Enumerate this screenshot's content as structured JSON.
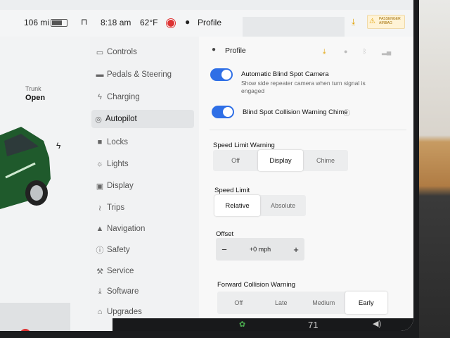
{
  "status": {
    "range": "106 mi",
    "time": "8:18 am",
    "temp": "62°F",
    "profile": "Profile",
    "airbag": "PASSENGER AIRBAG"
  },
  "car": {
    "trunk_label": "Trunk",
    "trunk_value": "Open"
  },
  "menu": [
    {
      "label": "Controls",
      "icon": "toggle-icon"
    },
    {
      "label": "Pedals & Steering",
      "icon": "car-icon"
    },
    {
      "label": "Charging",
      "icon": "bolt-icon"
    },
    {
      "label": "Autopilot",
      "icon": "steering-wheel-icon"
    },
    {
      "label": "Locks",
      "icon": "lock-icon"
    },
    {
      "label": "Lights",
      "icon": "sun-icon"
    },
    {
      "label": "Display",
      "icon": "display-icon"
    },
    {
      "label": "Trips",
      "icon": "trips-icon"
    },
    {
      "label": "Navigation",
      "icon": "navigation-icon"
    },
    {
      "label": "Safety",
      "icon": "safety-icon"
    },
    {
      "label": "Service",
      "icon": "wrench-icon"
    },
    {
      "label": "Software",
      "icon": "download-icon"
    },
    {
      "label": "Upgrades",
      "icon": "bag-icon"
    }
  ],
  "panel": {
    "profile": "Profile",
    "blind_spot_title": "Automatic Blind Spot Camera",
    "blind_spot_desc": "Show side repeater camera when turn signal is engaged",
    "chime_title": "Blind Spot Collision Warning Chime",
    "speed_warning_title": "Speed Limit Warning",
    "speed_warning_options": [
      "Off",
      "Display",
      "Chime"
    ],
    "speed_limit_title": "Speed Limit",
    "speed_limit_options": [
      "Relative",
      "Absolute"
    ],
    "offset_title": "Offset",
    "offset_value": "+0 mph",
    "offset_minus": "−",
    "offset_plus": "+",
    "fcw_title": "Forward Collision Warning",
    "fcw_options": [
      "Off",
      "Late",
      "Medium",
      "Early"
    ]
  },
  "dock": {
    "temp": "71"
  }
}
